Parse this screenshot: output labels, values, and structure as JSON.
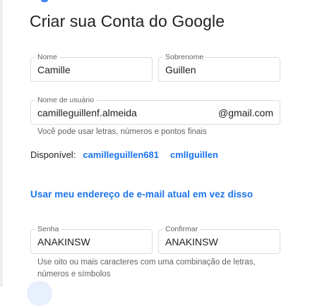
{
  "page": {
    "title": "Criar sua Conta do Google"
  },
  "first_name": {
    "label": "Nome",
    "value": "Camille"
  },
  "last_name": {
    "label": "Sobrenome",
    "value": "Guillen"
  },
  "username": {
    "label": "Nome de usuário",
    "value": "camilleguillenf.almeida",
    "suffix": "@gmail.com",
    "helper": "Você pode usar letras, números e pontos finais"
  },
  "availability": {
    "label": "Disponível:",
    "suggestions": [
      "camilleguillen681",
      "cmllguillen"
    ]
  },
  "use_existing_email": {
    "label": "Usar meu endereço de e-mail atual em vez disso"
  },
  "password": {
    "label": "Senha",
    "value": "ANAKINSW"
  },
  "confirm_password": {
    "label": "Confirmar",
    "value": "ANAKINSW"
  },
  "password_helper": "Use oito ou mais caracteres com uma combinação de letras, números e símbolos",
  "colors": {
    "link": "#1a73e8",
    "border": "#dadce0",
    "helper_text": "#5f6368"
  }
}
